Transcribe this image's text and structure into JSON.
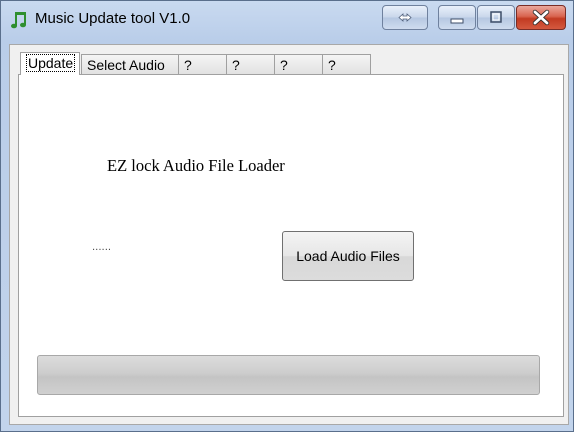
{
  "window": {
    "title": "Music Update tool V1.0",
    "icon": "music-notes-icon"
  },
  "tabs": [
    {
      "label": "Update",
      "active": true
    },
    {
      "label": "Select Audio"
    },
    {
      "label": "?"
    },
    {
      "label": "?"
    },
    {
      "label": "?"
    },
    {
      "label": "?"
    }
  ],
  "panel": {
    "heading": "EZ lock Audio File Loader",
    "status_text": "......",
    "load_button_label": "Load Audio Files",
    "progress": 0
  },
  "colors": {
    "titlebar": "#c2d4ec",
    "close_button": "#c23b22",
    "app_icon_green": "#2f8f2f"
  }
}
